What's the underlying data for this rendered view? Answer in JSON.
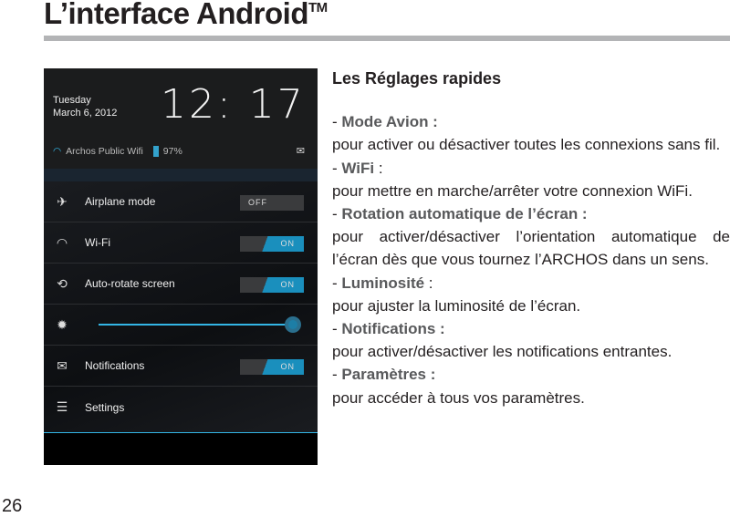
{
  "page": {
    "title": "L’interface Android",
    "trademark": "TM",
    "page_number": "26"
  },
  "screenshot": {
    "day": "Tuesday",
    "date": "March 6, 2012",
    "time": "12: 17",
    "wifi_name": "Archos Public Wifi",
    "battery": "97%",
    "rows": [
      {
        "label": "Airplane mode",
        "toggle": "OFF"
      },
      {
        "label": "Wi-Fi",
        "toggle": "ON"
      },
      {
        "label": "Auto-rotate screen",
        "toggle": "ON"
      },
      {
        "label": "",
        "brightness": 1.0
      },
      {
        "label": "Notifications",
        "toggle": "ON"
      },
      {
        "label": "Settings"
      }
    ],
    "accent": "#33b5e5"
  },
  "content": {
    "heading": "Les Réglages rapides",
    "items": [
      {
        "dash": "- ",
        "term": "Mode Avion :",
        "desc": "pour activer ou désactiver toutes les connexions sans fil."
      },
      {
        "dash": "- ",
        "term": "WiFi",
        "colon": " :",
        "desc": "pour mettre en marche/arrêter votre connexion WiFi."
      },
      {
        "dash": "- ",
        "term": "Rotation automatique de l’écran :",
        "desc": "pour activer/désactiver l’orientation automatique de l’écran dès que vous tournez l’ARCHOS dans un sens."
      },
      {
        "dash": "- ",
        "term": "Luminosité",
        "colon": " :",
        "desc": "pour ajuster la luminosité de l’écran."
      },
      {
        "dash": "- ",
        "term": "Notifications :",
        "desc": "pour activer/désactiver les notifications entrantes."
      },
      {
        "dash": "- ",
        "term": "Paramètres :",
        "desc": "pour accéder à tous vos paramètres."
      }
    ]
  }
}
